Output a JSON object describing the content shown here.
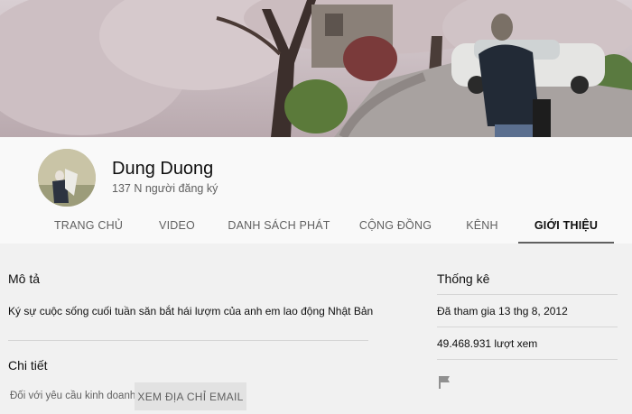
{
  "channel": {
    "name": "Dung Duong",
    "subscribers": "137 N người đăng ký"
  },
  "tabs": [
    {
      "label": "TRANG CHỦ",
      "active": false
    },
    {
      "label": "VIDEO",
      "active": false
    },
    {
      "label": "DANH SÁCH PHÁT",
      "active": false
    },
    {
      "label": "CỘNG ĐỒNG",
      "active": false
    },
    {
      "label": "KÊNH",
      "active": false
    },
    {
      "label": "GIỚI THIỆU",
      "active": true
    }
  ],
  "about": {
    "description_title": "Mô tả",
    "description": "Ký sự cuộc sống cuối tuần săn bắt hái lượm của anh em lao động Nhật Bản",
    "details_title": "Chi tiết",
    "business_label": "Đối với yêu cầu kinh doanh:",
    "email_button": "XEM ĐỊA CHỈ EMAIL"
  },
  "stats": {
    "title": "Thống kê",
    "joined": "Đã tham gia 13 thg 8, 2012",
    "views": "49.468.931 lượt xem"
  },
  "icons": {
    "report": "flag-icon"
  },
  "colors": {
    "background": "#f1f1f1",
    "header": "#f9f9f9",
    "active_tab_underline": "#606060",
    "secondary_text": "#606060"
  }
}
